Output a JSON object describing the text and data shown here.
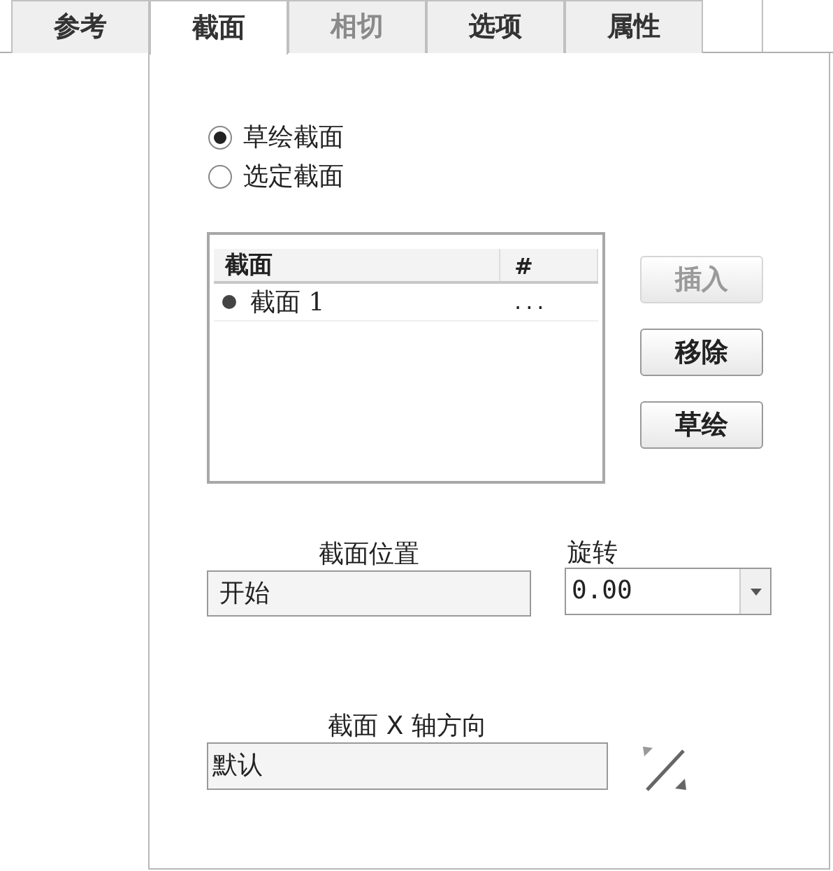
{
  "tabs": [
    {
      "label": "参考",
      "selected": false,
      "disabled": false
    },
    {
      "label": "截面",
      "selected": true,
      "disabled": false
    },
    {
      "label": "相切",
      "selected": false,
      "disabled": true
    },
    {
      "label": "选项",
      "selected": false,
      "disabled": false
    },
    {
      "label": "属性",
      "selected": false,
      "disabled": false
    }
  ],
  "radios": [
    {
      "label": "草绘截面",
      "selected": true
    },
    {
      "label": "选定截面",
      "selected": false
    }
  ],
  "section_list": {
    "columns": [
      "截面",
      "#"
    ],
    "rows": [
      {
        "name": "截面 1",
        "value": "...",
        "selected": true
      }
    ]
  },
  "buttons": [
    {
      "label": "插入",
      "disabled": true
    },
    {
      "label": "移除",
      "disabled": false
    },
    {
      "label": "草绘",
      "disabled": false
    }
  ],
  "position": {
    "label": "截面位置",
    "value": "开始"
  },
  "rotation": {
    "label": "旋转",
    "value": "0.00"
  },
  "x_axis": {
    "label": "截面 X 轴方向",
    "value": "默认"
  }
}
